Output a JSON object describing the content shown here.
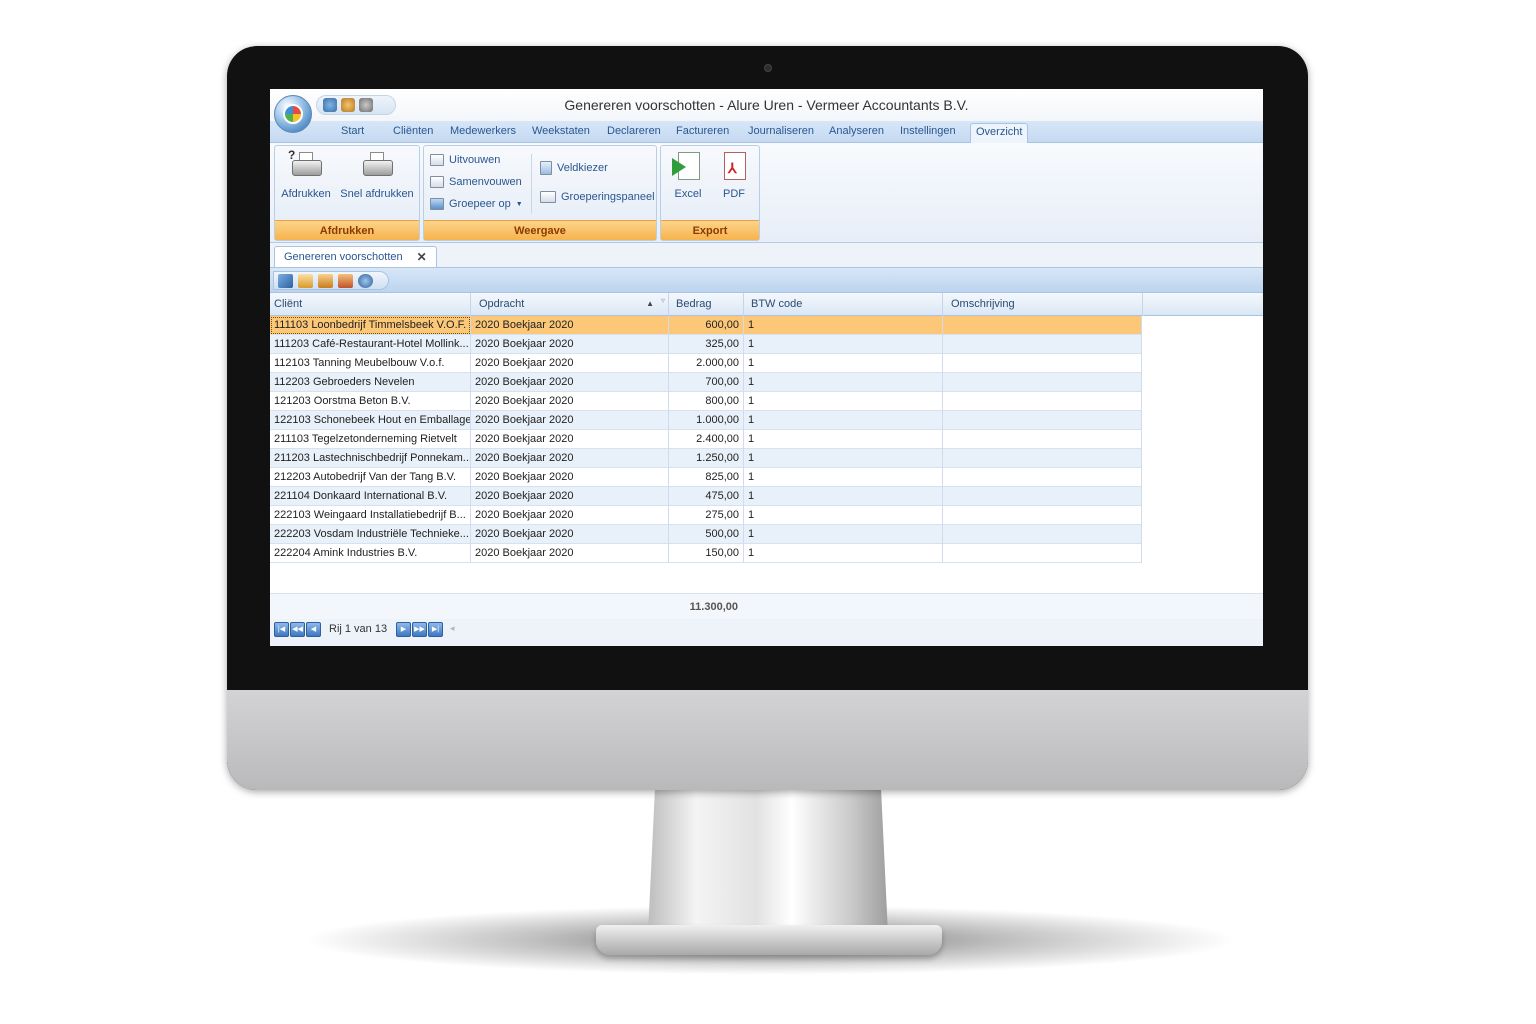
{
  "window": {
    "title": "Genereren voorschotten - Alure Uren - Vermeer Accountants B.V."
  },
  "ribbon_tabs": [
    "Start",
    "Cliënten",
    "Medewerkers",
    "Weekstaten",
    "Declareren",
    "Factureren",
    "Journaliseren",
    "Analyseren",
    "Instellingen",
    "Overzicht"
  ],
  "active_tab": "Overzicht",
  "ribbon": {
    "afdrukken": {
      "label": "Afdrukken",
      "print": "Afdrukken",
      "quick_print": "Snel afdrukken"
    },
    "weergave": {
      "label": "Weergave",
      "expand": "Uitvouwen",
      "collapse": "Samenvouwen",
      "group_by": "Groepeer op",
      "field_chooser": "Veldkiezer",
      "group_panel": "Groeperingspaneel"
    },
    "export": {
      "label": "Export",
      "excel": "Excel",
      "pdf": "PDF"
    }
  },
  "document_tab": {
    "label": "Genereren voorschotten",
    "close": "✕"
  },
  "grid": {
    "columns": {
      "client": "Cliënt",
      "opdracht": "Opdracht",
      "bedrag": "Bedrag",
      "btw": "BTW code",
      "omschrijving": "Omschrijving"
    },
    "sort_indicator": "▲",
    "rows": [
      {
        "client": "111103 Loonbedrijf Timmelsbeek V.O.F.",
        "opdracht": "2020 Boekjaar 2020",
        "bedrag": "600,00",
        "btw": "1",
        "omschrijving": ""
      },
      {
        "client": "111203 Café-Restaurant-Hotel Mollink...",
        "opdracht": "2020 Boekjaar 2020",
        "bedrag": "325,00",
        "btw": "1",
        "omschrijving": ""
      },
      {
        "client": "112103 Tanning Meubelbouw V.o.f.",
        "opdracht": "2020 Boekjaar 2020",
        "bedrag": "2.000,00",
        "btw": "1",
        "omschrijving": ""
      },
      {
        "client": "112203 Gebroeders Nevelen",
        "opdracht": "2020 Boekjaar 2020",
        "bedrag": "700,00",
        "btw": "1",
        "omschrijving": ""
      },
      {
        "client": "121203 Oorstma Beton B.V.",
        "opdracht": "2020 Boekjaar 2020",
        "bedrag": "800,00",
        "btw": "1",
        "omschrijving": ""
      },
      {
        "client": "122103 Schonebeek Hout en Emballage",
        "opdracht": "2020 Boekjaar 2020",
        "bedrag": "1.000,00",
        "btw": "1",
        "omschrijving": ""
      },
      {
        "client": "211103 Tegelzetonderneming Rietvelt",
        "opdracht": "2020 Boekjaar 2020",
        "bedrag": "2.400,00",
        "btw": "1",
        "omschrijving": ""
      },
      {
        "client": "211203 Lastechnischbedrijf Ponnekam...",
        "opdracht": "2020 Boekjaar 2020",
        "bedrag": "1.250,00",
        "btw": "1",
        "omschrijving": ""
      },
      {
        "client": "212203 Autobedrijf Van der Tang B.V.",
        "opdracht": "2020 Boekjaar 2020",
        "bedrag": "825,00",
        "btw": "1",
        "omschrijving": ""
      },
      {
        "client": "221104 Donkaard International B.V.",
        "opdracht": "2020 Boekjaar 2020",
        "bedrag": "475,00",
        "btw": "1",
        "omschrijving": ""
      },
      {
        "client": "222103 Weingaard Installatiebedrijf B...",
        "opdracht": "2020 Boekjaar 2020",
        "bedrag": "275,00",
        "btw": "1",
        "omschrijving": ""
      },
      {
        "client": "222203 Vosdam Industriële Technieke...",
        "opdracht": "2020 Boekjaar 2020",
        "bedrag": "500,00",
        "btw": "1",
        "omschrijving": ""
      },
      {
        "client": "222204 Amink Industries B.V.",
        "opdracht": "2020 Boekjaar 2020",
        "bedrag": "150,00",
        "btw": "1",
        "omschrijving": ""
      }
    ],
    "selected_row": 0,
    "total": "11.300,00"
  },
  "navigator": {
    "text": "Rij 1 van 13"
  },
  "colors": {
    "selected_row": "#fcc777",
    "group_label": "#f7b34d",
    "accent_text": "#2a5690"
  }
}
